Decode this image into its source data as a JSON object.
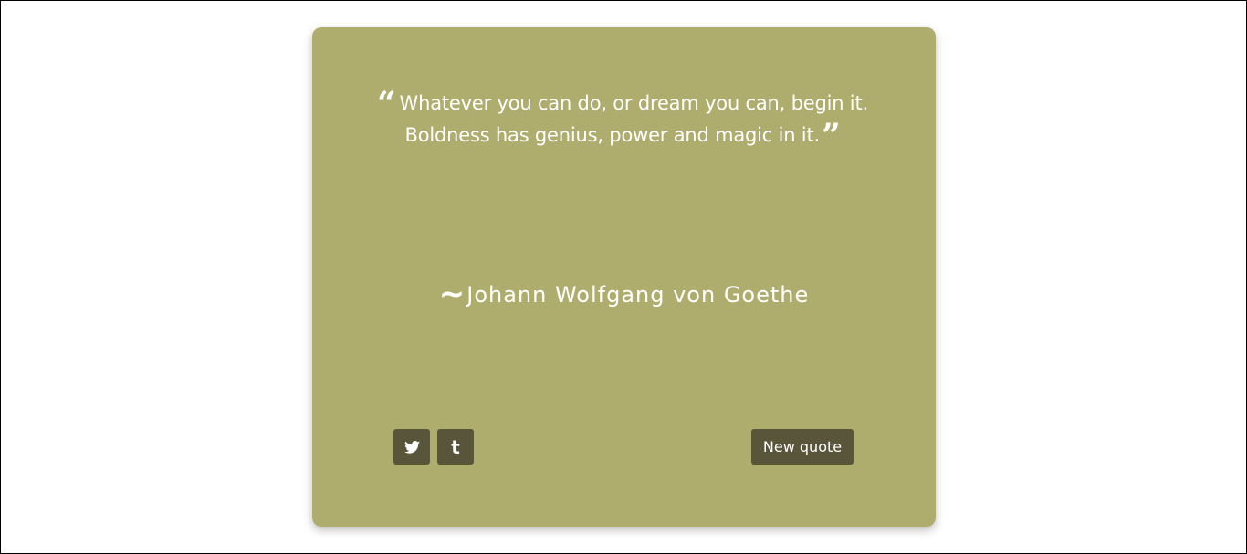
{
  "quote": {
    "open_mark": "“",
    "text": "Whatever you can do, or dream you can, begin it. Boldness has genius, power and magic in it.",
    "close_mark": "”"
  },
  "author": {
    "prefix": "~",
    "name": "Johann Wolfgang von Goethe"
  },
  "buttons": {
    "twitter_icon": "twitter-icon",
    "tumblr_icon": "tumblr-icon",
    "tumblr_glyph": "t",
    "new_quote_label": "New quote"
  },
  "colors": {
    "card_background": "#aead6d",
    "button_background": "#58553b",
    "text": "#ffffff"
  }
}
